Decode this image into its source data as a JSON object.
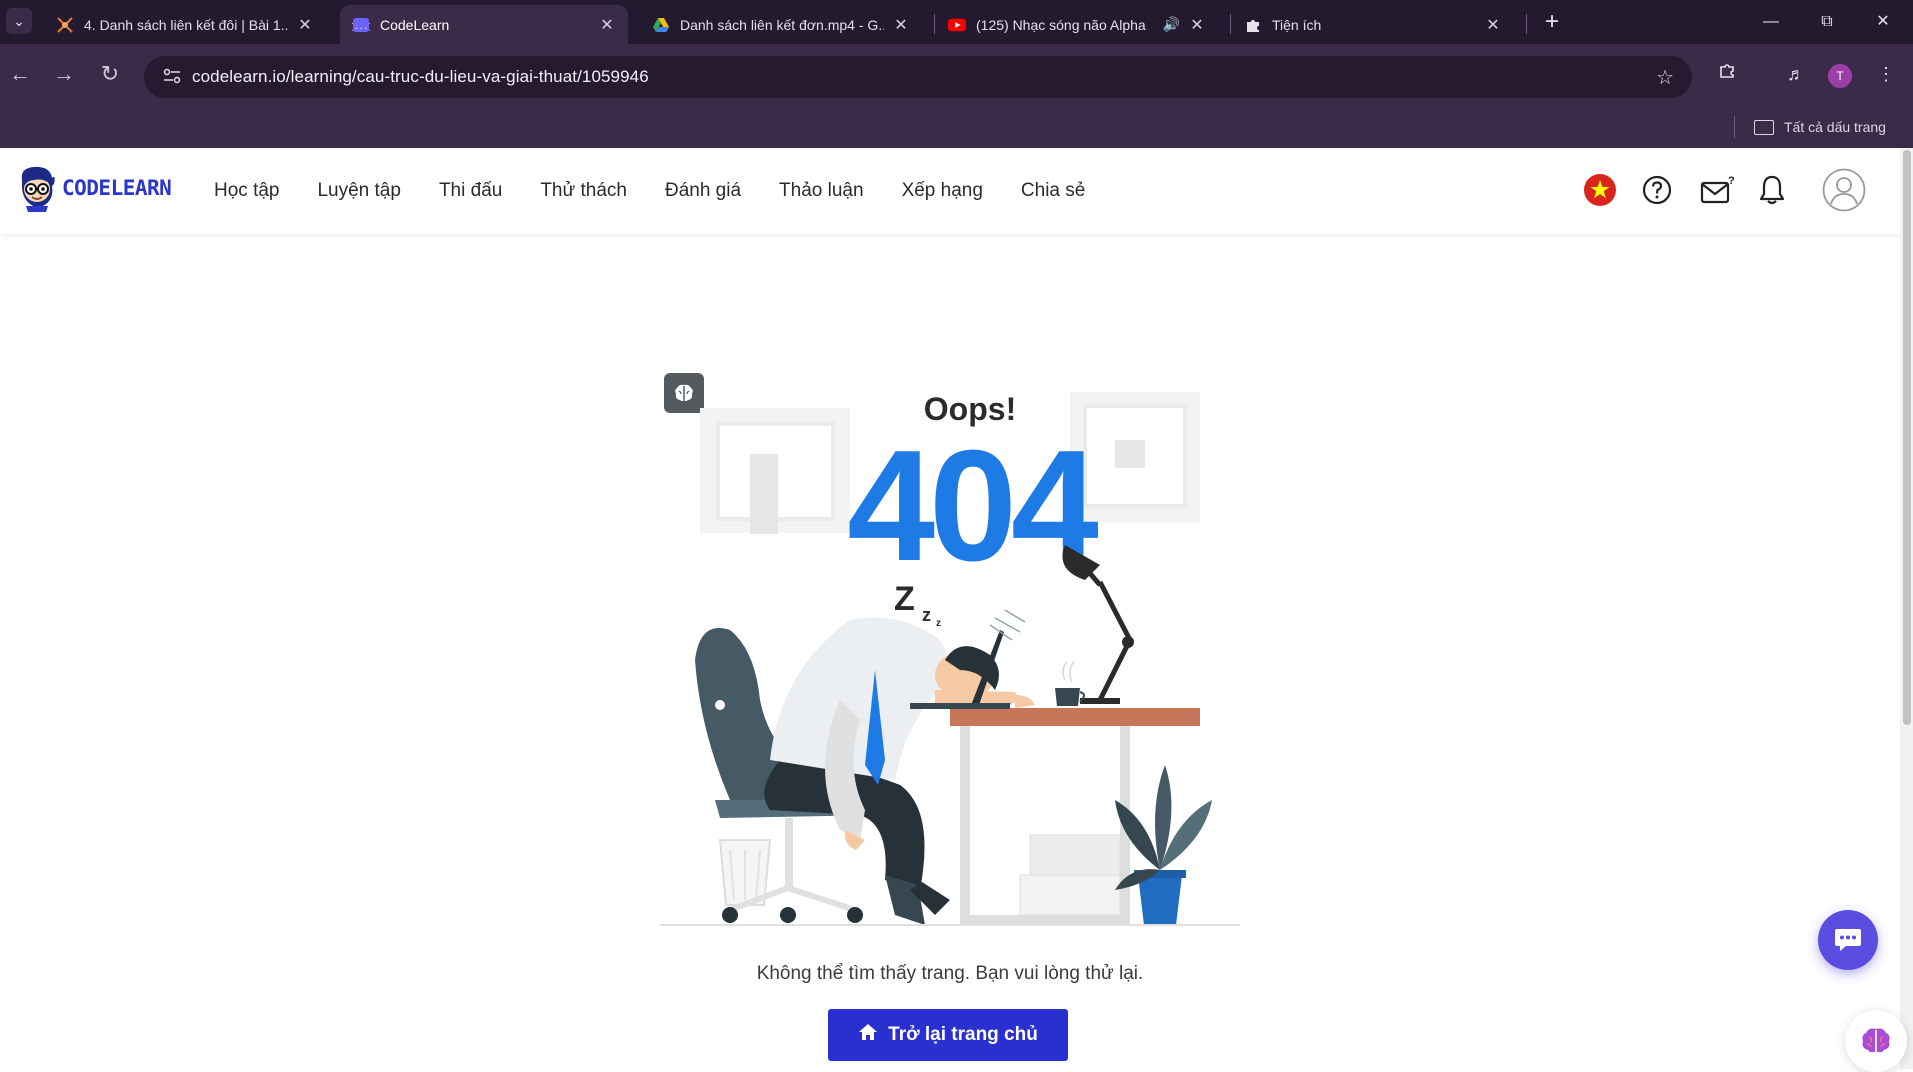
{
  "browser": {
    "tabs": [
      {
        "title": "4. Danh sách liên kết đôi | Bài 1...",
        "icon": "codelearn-lesson-icon",
        "active": false
      },
      {
        "title": "CodeLearn",
        "icon": "codelearn-tab-icon",
        "active": true
      },
      {
        "title": "Danh sách liên kết đơn.mp4 - G...",
        "icon": "google-drive-icon",
        "active": false
      },
      {
        "title": "(125) Nhạc sóng não Alpha",
        "icon": "youtube-icon",
        "active": false
      },
      {
        "title": "Tiện ích",
        "icon": "puzzle-icon",
        "active": false
      }
    ],
    "url": "codelearn.io/learning/cau-truc-du-lieu-va-giai-thuat/1059946",
    "profile_initial": "T",
    "bookmarks_all": "Tất cả dấu trang"
  },
  "site": {
    "logo_text": "CODELEARN",
    "nav": [
      "Học tập",
      "Luyện tập",
      "Thi đấu",
      "Thử thách",
      "Đánh giá",
      "Thảo luận",
      "Xếp hạng",
      "Chia sẻ"
    ],
    "colors": {
      "brand": "#2a2fd0",
      "accent_404": "#1e7be6",
      "flag_red": "#da251d",
      "flag_star": "#ffff00"
    }
  },
  "error": {
    "oops": "Oops!",
    "code": "404",
    "snore": "Z",
    "snore_small": "z",
    "message": "Không thể tìm thấy trang. Bạn vui lòng thử lại.",
    "button_label": "Trở lại trang chủ"
  }
}
